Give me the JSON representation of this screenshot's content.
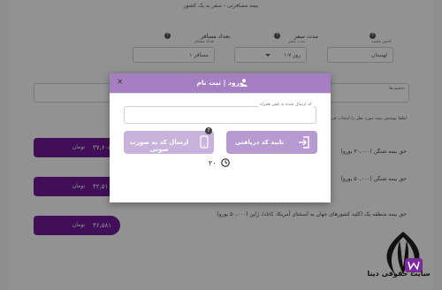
{
  "background": {
    "section_title": "بیمه مسافرتی - سفر به یک کشور",
    "fields": {
      "passengers": {
        "label": "تعداد مسافر",
        "sublabel": "تعداد مسافر",
        "value": "۱ مسافر",
        "help": "?"
      },
      "duration": {
        "label": "مدت سفر",
        "sublabel": "مدت سفر",
        "value": "۱-۷ روز",
        "help": "?"
      },
      "country": {
        "label": "کشور مقصد",
        "sublabel": "کشور مقصد",
        "value": "لهستان",
        "help": "?"
      }
    },
    "discount_label": "تخفیف‌ها",
    "hint": "لطفا پوشش بیمه مورد نظر را انتخاب فر",
    "plans": [
      {
        "text": "حق بیمه شنگن (۳۰,۰۰۰ یورو)",
        "price": "۳۷,۶۰۵",
        "unit": "تومان"
      },
      {
        "text": "حق بیمه شنگن (۵۰,۰۰۰ یورو)",
        "price": "۴۲,۵۱۰",
        "unit": "تومان"
      },
      {
        "text": "حق بیمه منطقه یک (کلیه کشورهای جهان به استثنای آمریکا، کانادا، ژاپن (۵۰,۰۰۰ یورو)",
        "price": "۴۶,۵۸۱",
        "unit": "تومان"
      }
    ]
  },
  "modal": {
    "title": "ورود | ثبت نام",
    "close_label": "×",
    "phone_input_legend": "کد ارسال شده به تلفن همراه",
    "phone_input_value": "",
    "confirm_button": "تایید کد دریافتی",
    "voice_button": "ارسال کد به صورت صوتی",
    "help": "?",
    "timer": "۲۰"
  },
  "watermark": {
    "text": "سایت حقوقی دینا"
  },
  "colors": {
    "brand_purple": "#6f1a96",
    "modal_header": "#a57fc2",
    "confirm_button": "#b69ad0",
    "voice_button": "#c9b3dc"
  }
}
